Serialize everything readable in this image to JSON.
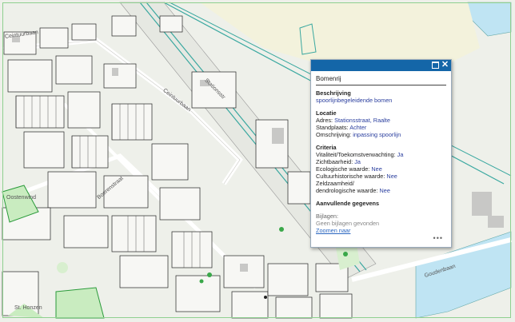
{
  "map": {
    "streets": [
      "Ceintuurbaan",
      "Ceintuurbaan",
      "Stationsstr",
      "Boerenstraat",
      "Oostenwind",
      "Goudenbaan"
    ],
    "places": [
      "St. Honzen"
    ]
  },
  "popup": {
    "title": "Bomenrij",
    "description": {
      "heading": "Beschrijving",
      "value": "spoorlijnbegeleidende bomen"
    },
    "location": {
      "heading": "Locatie",
      "rows": [
        {
          "label": "Adres:",
          "value": "Stationsstraat, Raalte"
        },
        {
          "label": "Standplaats:",
          "value": "Achter"
        },
        {
          "label": "Omschrijving:",
          "value": "inpassing spoorlijn"
        }
      ]
    },
    "criteria": {
      "heading": "Criteria",
      "rows": [
        {
          "label": "Vitaliteit/Toekomstverwachting:",
          "value": "Ja"
        },
        {
          "label": "Zichtbaarheid:",
          "value": "Ja"
        },
        {
          "label": "Ecologische waarde:",
          "value": "Nee"
        },
        {
          "label": "Cultuurhistorische waarde:",
          "value": "Nee"
        },
        {
          "label": "Zeldzaamheid/",
          "value": ""
        },
        {
          "label": "dendrologische waarde:",
          "value": "Nee"
        }
      ]
    },
    "extra": {
      "heading": "Aanvullende gegevens"
    },
    "attachments": {
      "label": "Bijlagen:",
      "empty": "Geen bijlagen gevonden"
    },
    "zoom_link": "Zoomen naar",
    "more": "•••",
    "close_icon": "close-icon",
    "maximize_icon": "maximize-icon"
  }
}
